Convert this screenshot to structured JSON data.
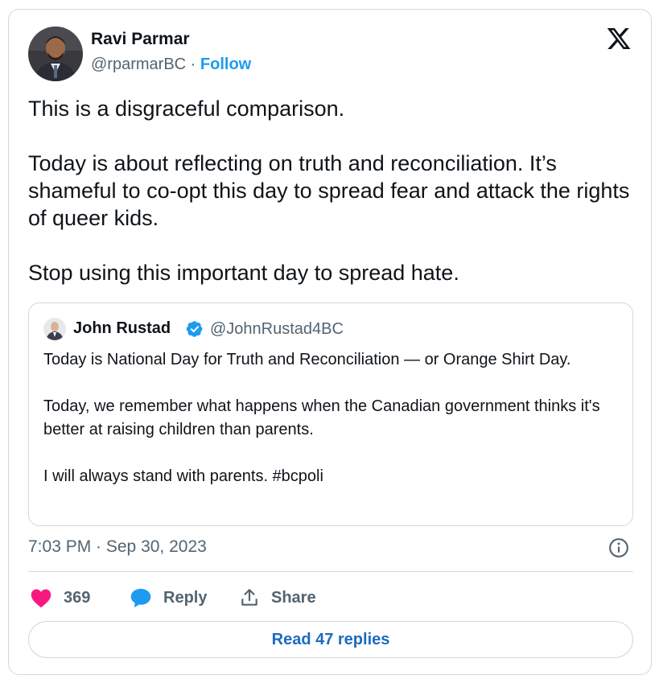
{
  "author": {
    "name": "Ravi Parmar",
    "handle": "@rparmarBC",
    "separator": " · ",
    "follow_label": "Follow"
  },
  "tweet": {
    "text": "This is a disgraceful comparison.\n\nToday is about reflecting on truth and reconciliation. It’s shameful to co-opt this day to spread fear and attack the rights of queer kids.\n\nStop using this important day to spread hate."
  },
  "quoted_tweet": {
    "name": "John Rustad",
    "handle": "@JohnRustad4BC",
    "verified": true,
    "text": "Today is National Day for Truth and Reconciliation — or Orange Shirt Day.\n\nToday, we remember what happens when the Canadian government thinks it's better at raising children than parents.\n\nI will always stand with parents. #bcpoli"
  },
  "meta": {
    "timestamp": "7:03 PM · Sep 30, 2023"
  },
  "actions": {
    "like_count": "369",
    "reply_label": "Reply",
    "share_label": "Share"
  },
  "footer": {
    "read_replies_label": "Read 47 replies"
  },
  "colors": {
    "accent": "#1d9bf0",
    "like": "#f91880",
    "secondary_text": "#536471",
    "border": "#cfd9de"
  },
  "icons": [
    "x-logo-icon",
    "verified-badge-icon",
    "info-icon",
    "heart-icon",
    "reply-bubble-icon",
    "share-icon"
  ]
}
